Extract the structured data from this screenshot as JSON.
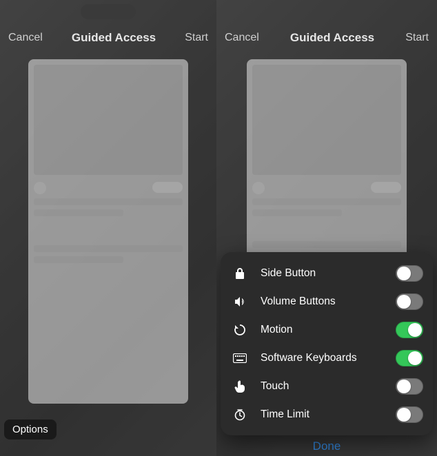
{
  "left": {
    "cancel": "Cancel",
    "title": "Guided Access",
    "start": "Start",
    "options_button": "Options"
  },
  "right": {
    "cancel": "Cancel",
    "title": "Guided Access",
    "start": "Start",
    "done": "Done",
    "options": [
      {
        "icon": "lock-icon",
        "label": "Side Button",
        "on": false
      },
      {
        "icon": "volume-icon",
        "label": "Volume Buttons",
        "on": false
      },
      {
        "icon": "motion-icon",
        "label": "Motion",
        "on": true
      },
      {
        "icon": "keyboard-icon",
        "label": "Software Keyboards",
        "on": true
      },
      {
        "icon": "touch-icon",
        "label": "Touch",
        "on": false
      },
      {
        "icon": "timer-icon",
        "label": "Time Limit",
        "on": false
      }
    ]
  }
}
